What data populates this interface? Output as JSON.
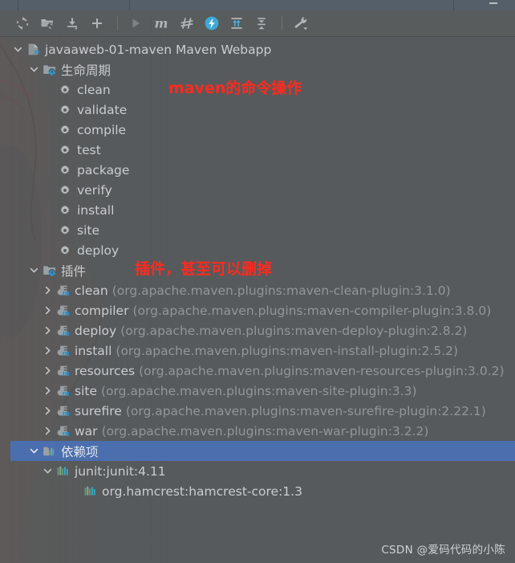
{
  "window": {
    "background_color": "#565a5c",
    "strip_color": "#555f69",
    "selection_color": "#4b6eaf",
    "annotation_color": "#ff2a1f",
    "accent_color": "#4ab3e0"
  },
  "toolbar": {
    "buttons": [
      {
        "name": "reimport-icon",
        "tip": "Reload All Maven Projects",
        "state": "enabled"
      },
      {
        "name": "generate-sources-icon",
        "tip": "Generate Sources and Update Folders",
        "state": "enabled"
      },
      {
        "name": "download-sources-icon",
        "tip": "Download Sources and/or Documentation",
        "state": "enabled"
      },
      {
        "name": "add-maven-project-icon",
        "tip": "Add Maven Projects",
        "state": "enabled"
      },
      {
        "name": "separator-1",
        "tip": "",
        "state": "separator"
      },
      {
        "name": "run-icon",
        "tip": "Run",
        "state": "disabled"
      },
      {
        "name": "maven-m-icon",
        "tip": "Execute Maven Goal",
        "state": "enabled"
      },
      {
        "name": "skip-tests-icon",
        "tip": "Toggle Skip Tests Mode",
        "state": "enabled"
      },
      {
        "name": "offline-mode-icon",
        "tip": "Toggle Offline Mode",
        "state": "active"
      },
      {
        "name": "expand-all-icon",
        "tip": "Expand All",
        "state": "accent"
      },
      {
        "name": "collapse-all-icon",
        "tip": "Collapse All",
        "state": "enabled"
      },
      {
        "name": "separator-2",
        "tip": "",
        "state": "separator"
      },
      {
        "name": "settings-wrench-icon",
        "tip": "Maven Settings",
        "state": "enabled"
      }
    ]
  },
  "tree": {
    "root": {
      "label": "javaaweb-01-maven Maven Webapp",
      "icon": "maven-module-icon",
      "expanded": true
    },
    "lifecycle": {
      "label": "生命周期",
      "icon": "lifecycle-folder-icon",
      "expanded": true,
      "goals": [
        {
          "label": "clean",
          "icon": "goal-gear-icon"
        },
        {
          "label": "validate",
          "icon": "goal-gear-icon"
        },
        {
          "label": "compile",
          "icon": "goal-gear-icon"
        },
        {
          "label": "test",
          "icon": "goal-gear-icon"
        },
        {
          "label": "package",
          "icon": "goal-gear-icon"
        },
        {
          "label": "verify",
          "icon": "goal-gear-icon"
        },
        {
          "label": "install",
          "icon": "goal-gear-icon"
        },
        {
          "label": "site",
          "icon": "goal-gear-icon"
        },
        {
          "label": "deploy",
          "icon": "goal-gear-icon"
        }
      ]
    },
    "plugins": {
      "label": "插件",
      "icon": "plugins-folder-icon",
      "expanded": true,
      "items": [
        {
          "label": "clean",
          "coord": "(org.apache.maven.plugins:maven-clean-plugin:3.1.0)",
          "icon": "plugin-icon",
          "expanded": false
        },
        {
          "label": "compiler",
          "coord": "(org.apache.maven.plugins:maven-compiler-plugin:3.8.0)",
          "icon": "plugin-icon",
          "expanded": false
        },
        {
          "label": "deploy",
          "coord": "(org.apache.maven.plugins:maven-deploy-plugin:2.8.2)",
          "icon": "plugin-icon",
          "expanded": false
        },
        {
          "label": "install",
          "coord": "(org.apache.maven.plugins:maven-install-plugin:2.5.2)",
          "icon": "plugin-icon",
          "expanded": false
        },
        {
          "label": "resources",
          "coord": "(org.apache.maven.plugins:maven-resources-plugin:3.0.2)",
          "icon": "plugin-icon",
          "expanded": false
        },
        {
          "label": "site",
          "coord": "(org.apache.maven.plugins:maven-site-plugin:3.3)",
          "icon": "plugin-icon",
          "expanded": false
        },
        {
          "label": "surefire",
          "coord": "(org.apache.maven.plugins:maven-surefire-plugin:2.22.1)",
          "icon": "plugin-icon",
          "expanded": false
        },
        {
          "label": "war",
          "coord": "(org.apache.maven.plugins:maven-war-plugin:3.2.2)",
          "icon": "plugin-icon",
          "expanded": false
        }
      ]
    },
    "dependencies": {
      "label": "依赖项",
      "icon": "dependencies-icon",
      "expanded": true,
      "selected": true,
      "items": [
        {
          "label": "junit:junit:4.11",
          "icon": "dependency-icon",
          "expanded": true,
          "level": 2
        },
        {
          "label": "org.hamcrest:hamcrest-core:1.3",
          "icon": "dependency-icon",
          "expanded": false,
          "level": 3
        }
      ]
    }
  },
  "annotations": [
    {
      "name": "annotation-maven-commands",
      "text": "maven的命令操作"
    },
    {
      "name": "annotation-plugins-note",
      "text": "插件，甚至可以删掉"
    }
  ],
  "watermark": {
    "text": "CSDN @爱码代码的小陈"
  }
}
